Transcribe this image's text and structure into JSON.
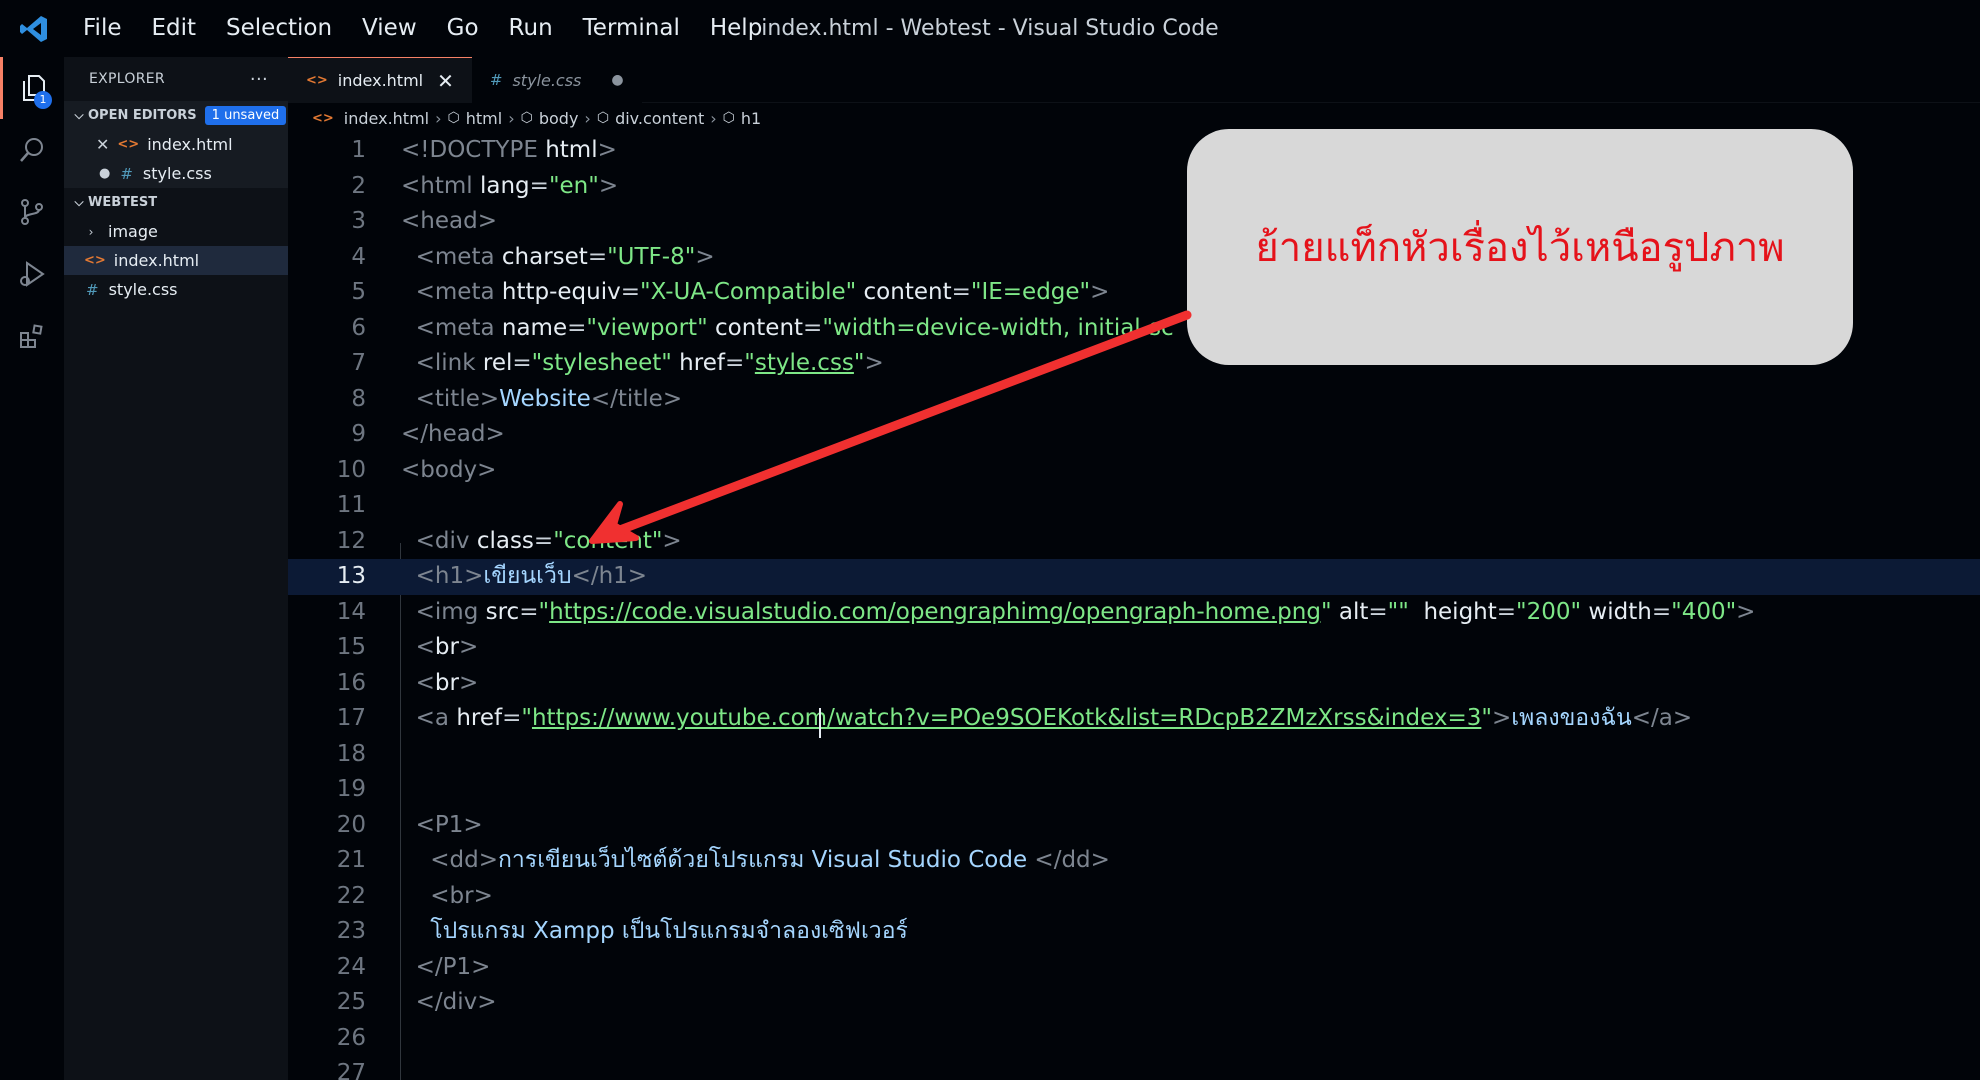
{
  "window": {
    "title": "index.html - Webtest - Visual Studio Code"
  },
  "menu": [
    "File",
    "Edit",
    "Selection",
    "View",
    "Go",
    "Run",
    "Terminal",
    "Help"
  ],
  "activity": {
    "explorer_badge": "1"
  },
  "sidebar": {
    "header": "EXPLORER",
    "more": "···",
    "open_editors": {
      "label": "OPEN EDITORS",
      "badge": "1 unsaved",
      "files": [
        {
          "name": "index.html",
          "status": "close"
        },
        {
          "name": "style.css",
          "status": "unsaved"
        }
      ]
    },
    "workspace": {
      "label": "WEBTEST",
      "items": [
        {
          "name": "image",
          "type": "folder"
        },
        {
          "name": "index.html",
          "type": "html"
        },
        {
          "name": "style.css",
          "type": "css"
        }
      ]
    }
  },
  "tabs": [
    {
      "label": "index.html",
      "active": true
    },
    {
      "label": "style.css",
      "active": false
    }
  ],
  "breadcrumb": [
    "index.html",
    "html",
    "body",
    "div.content",
    "h1"
  ],
  "code": {
    "current_line": 13,
    "line_numbers": [
      "1",
      "2",
      "3",
      "4",
      "5",
      "6",
      "7",
      "8",
      "9",
      "10",
      "11",
      "12",
      "13",
      "14",
      "15",
      "16",
      "17",
      "18",
      "19",
      "20",
      "21",
      "22",
      "23",
      "24",
      "25",
      "26",
      "27"
    ]
  },
  "callout": {
    "text": "ย้ายแท็กหัวเรื่องไว้เหนือรูปภาพ"
  },
  "colors": {
    "accent": "#1f6feb",
    "callout_text": "#e5121a",
    "arrow": "#f03030"
  }
}
